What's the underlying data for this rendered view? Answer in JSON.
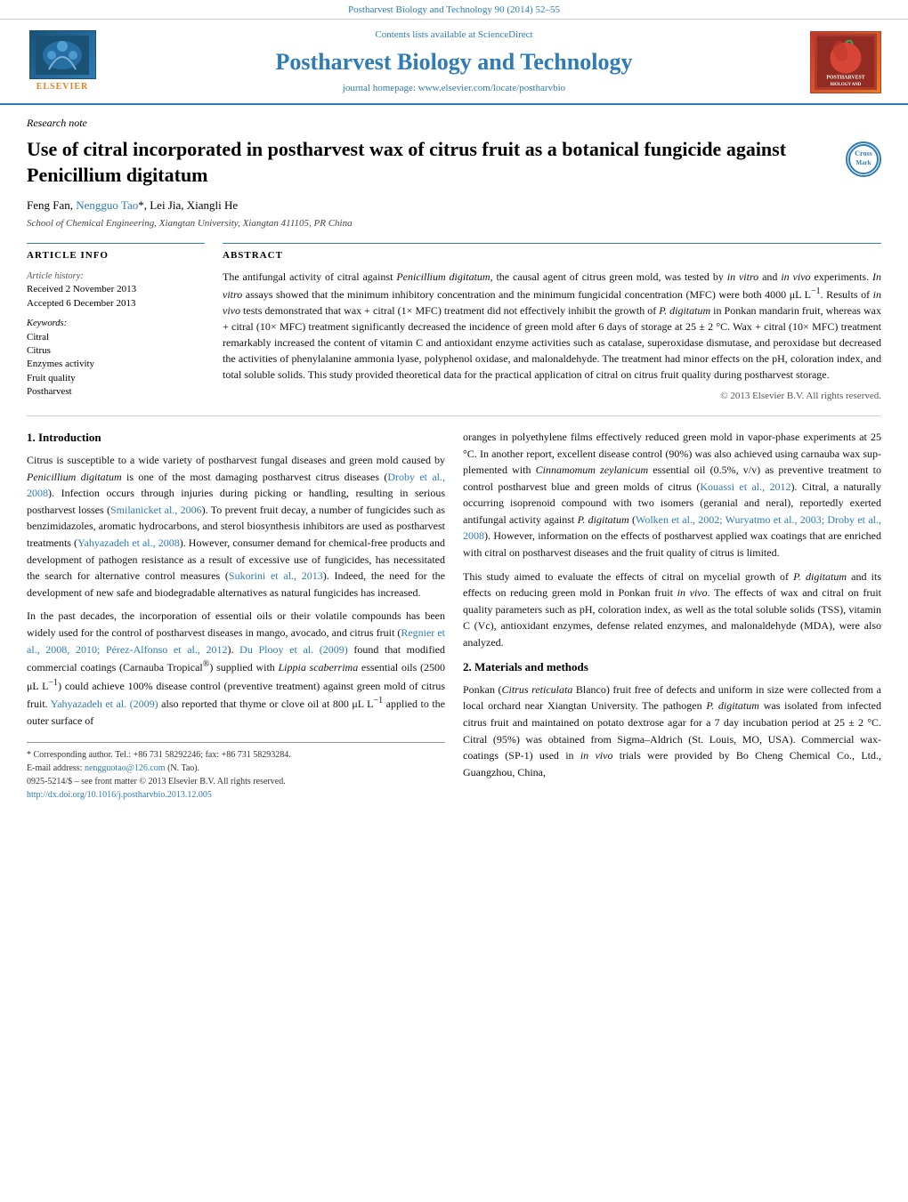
{
  "topbar": {
    "journal_ref": "Postharvest Biology and Technology 90 (2014) 52–55"
  },
  "header": {
    "sciencedirect_text": "Contents lists available at ScienceDirect",
    "journal_name": "Postharvest Biology and Technology",
    "homepage_text": "journal homepage: www.elsevier.com/locate/postharvbio",
    "elsevier_label": "ELSEVIER",
    "logo_right_label": "POSTHARVEST\nBIOLOGY\nAND\nTECHNOLOGY"
  },
  "article": {
    "type": "Research note",
    "title": "Use of citral incorporated in postharvest wax of citrus fruit as a botanical fungicide against Penicillium digitatum",
    "title_italic": "Penicillium digitatum",
    "authors": "Feng Fan, Nengguo Tao*, Lei Jia, Xiangli He",
    "affiliation": "School of Chemical Engineering, Xiangtan University, Xiangtan 411105, PR China",
    "article_info_title": "ARTICLE INFO",
    "history_label": "Article history:",
    "received": "Received 2 November 2013",
    "accepted": "Accepted 6 December 2013",
    "keywords_label": "Keywords:",
    "keywords": [
      "Citral",
      "Citrus",
      "Enzymes activity",
      "Fruit quality",
      "Postharvest"
    ],
    "abstract_title": "ABSTRACT",
    "abstract": "The antifungal activity of citral against Penicillium digitatum, the causal agent of citrus green mold, was tested by in vitro and in vivo experiments. In vitro assays showed that the minimum inhibitory concentration and the minimum fungicidal concentration (MFC) were both 4000 μL L−1. Results of in vivo tests demonstrated that wax + citral (1× MFC) treatment did not effectively inhibit the growth of P. digitatum in Ponkan mandarin fruit, whereas wax + citral (10× MFC) treatment significantly decreased the incidence of green mold after 6 days of storage at 25 ± 2 °C. Wax + citral (10× MFC) treatment remarkably increased the content of vitamin C and antioxidant enzyme activities such as catalase, superoxidase dismutase, and peroxidase but decreased the activities of phenylalanine ammonia lyase, polyphenol oxidase, and malonaldehyde. The treatment had minor effects on the pH, coloration index, and total soluble solids. This study provided theoretical data for the practical application of citral on citrus fruit quality during postharvest storage.",
    "copyright": "© 2013 Elsevier B.V. All rights reserved."
  },
  "body": {
    "section1_heading": "1.  Introduction",
    "section1_col1": [
      "Citrus is susceptible to a wide variety of postharvest fungal diseases and green mold caused by Penicillium digitatum is one of the most damaging postharvest citrus diseases (Droby et al., 2008). Infection occurs through injuries during picking or handling, resulting in serious postharvest losses (Smilanicket al., 2006). To prevent fruit decay, a number of fungicides such as benzimidazoles, aromatic hydrocarbons, and sterol biosynthesis inhibitors are used as postharvest treatments (Yahyazadeh et al., 2008). However, consumer demand for chemical-free products and development of pathogen resistance as a result of excessive use of fungicides, has necessitated the search for alternative control measures (Sukorini et al., 2013). Indeed, the need for the development of new safe and biodegradable alternatives as natural fungicides has increased.",
      "In the past decades, the incorporation of essential oils or their volatile compounds has been widely used for the control of postharvest diseases in mango, avocado, and citrus fruit (Regnier et al., 2008, 2010; Pérez-Alfonso et al., 2012). Du Plooy et al. (2009) found that modified commercial coatings (Carnauba Tropical®) supplied with Lippia scaberrima essential oils (2500 μL L−1) could achieve 100% disease control (preventive treatment) against green mold of citrus fruit. Yahyazadeh et al. (2009) also reported that thyme or clove oil at 800 μL L−1 applied to the outer surface of"
    ],
    "section1_col2": [
      "oranges in polyethylene films effectively reduced green mold in vapor-phase experiments at 25 °C. In another report, excellent disease control (90%) was also achieved using carnauba wax supplemented with Cinnamomum zeylanicum essential oil (0.5%, v/v) as preventive treatment to control postharvest blue and green molds of citrus (Kouassi et al., 2012). Citral, a naturally occurring isoprenoid compound with two isomers (geranial and neral), reportedly exerted antifungal activity against P. digitatum (Wolken et al., 2002; Wuryatmo et al., 2003; Droby et al., 2008). However, information on the effects of postharvest applied wax coatings that are enriched with citral on postharvest diseases and the fruit quality of citrus is limited.",
      "This study aimed to evaluate the effects of citral on mycelial growth of P. digitatum and its effects on reducing green mold in Ponkan fruit in vivo. The effects of wax and citral on fruit quality parameters such as pH, coloration index, as well as the total soluble solids (TSS), vitamin C (Vc), antioxidant enzymes, defense related enzymes, and malonaldehyde (MDA), were also analyzed."
    ],
    "section2_heading": "2.  Materials and methods",
    "section2_text": "Ponkan (Citrus reticulata Blanco) fruit free of defects and uniform in size were collected from a local orchard near Xiangtan University. The pathogen P. digitatum was isolated from infected citrus fruit and maintained on potato dextrose agar for a 7 day incubation period at 25 ± 2 °C. Citral (95%) was obtained from Sigma–Aldrich (St. Louis, MO, USA). Commercial wax-coatings (SP-1) used in in vivo trials were provided by Bo Cheng Chemical Co., Ltd., Guangzhou, China,"
  },
  "footnotes": {
    "corresponding": "* Corresponding author. Tel.: +86 731 58292246; fax: +86 731 58293284.",
    "email_label": "E-mail address:",
    "email": "nengguotao@126.com",
    "email_suffix": "(N. Tao).",
    "issn": "0925-5214/$ – see front matter © 2013 Elsevier B.V. All rights reserved.",
    "doi": "http://dx.doi.org/10.1016/j.postharvbio.2013.12.005"
  }
}
